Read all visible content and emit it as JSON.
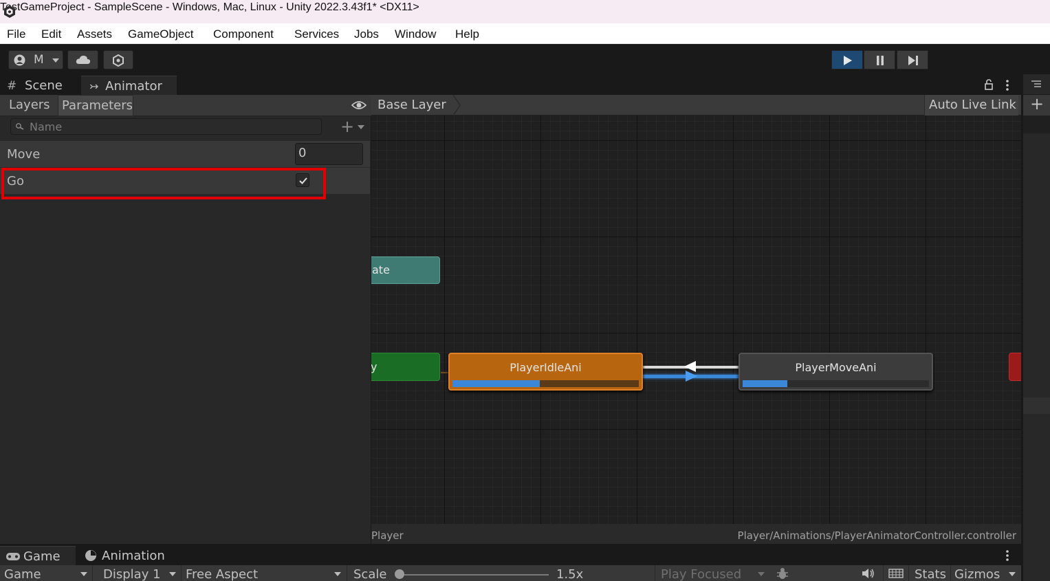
{
  "window": {
    "title": "TestGameProject - SampleScene - Windows, Mac, Linux - Unity 2022.3.43f1* <DX11>"
  },
  "menu": [
    "File",
    "Edit",
    "Assets",
    "GameObject",
    "Component",
    "Services",
    "Jobs",
    "Window",
    "Help"
  ],
  "toolbar": {
    "account_label": "M",
    "icons": [
      "account-icon",
      "cloud-icon",
      "collab-icon",
      "play-icon",
      "pause-icon",
      "step-icon"
    ]
  },
  "tabs": {
    "scene": "Scene",
    "animator": "Animator"
  },
  "animator": {
    "left_tabs": [
      "Layers",
      "Parameters"
    ],
    "search_placeholder": "Name",
    "parameters": [
      {
        "name": "Move",
        "type": "int",
        "value": "0"
      },
      {
        "name": "Go",
        "type": "bool",
        "value": true
      }
    ],
    "breadcrumb": "Base Layer",
    "auto_live_link": "Auto Live Link",
    "states": {
      "any_state_fragment": "ate",
      "entry_fragment": "y",
      "idle": {
        "label": "PlayerIdleAni",
        "progress": 0.47
      },
      "move": {
        "label": "PlayerMoveAni",
        "progress": 0.24
      }
    },
    "footer_left": "Player",
    "footer_right": "Player/Animations/PlayerAnimatorController.controller"
  },
  "bottom": {
    "tabs": [
      "Game",
      "Animation"
    ],
    "game_dropdown": "Game",
    "display": "Display 1",
    "aspect": "Free Aspect",
    "scale_label": "Scale",
    "scale_value": "1.5x",
    "play_mode": "Play Focused",
    "stats": "Stats",
    "gizmos": "Gizmos"
  },
  "colors": {
    "highlight": "#e10000",
    "idle_state": "#b8650f",
    "move_state": "#3c3c3c",
    "entry_state": "#1a6d25",
    "any_state": "#3f7b72",
    "progress": "#3a87d8",
    "play_active": "#1d4972"
  }
}
